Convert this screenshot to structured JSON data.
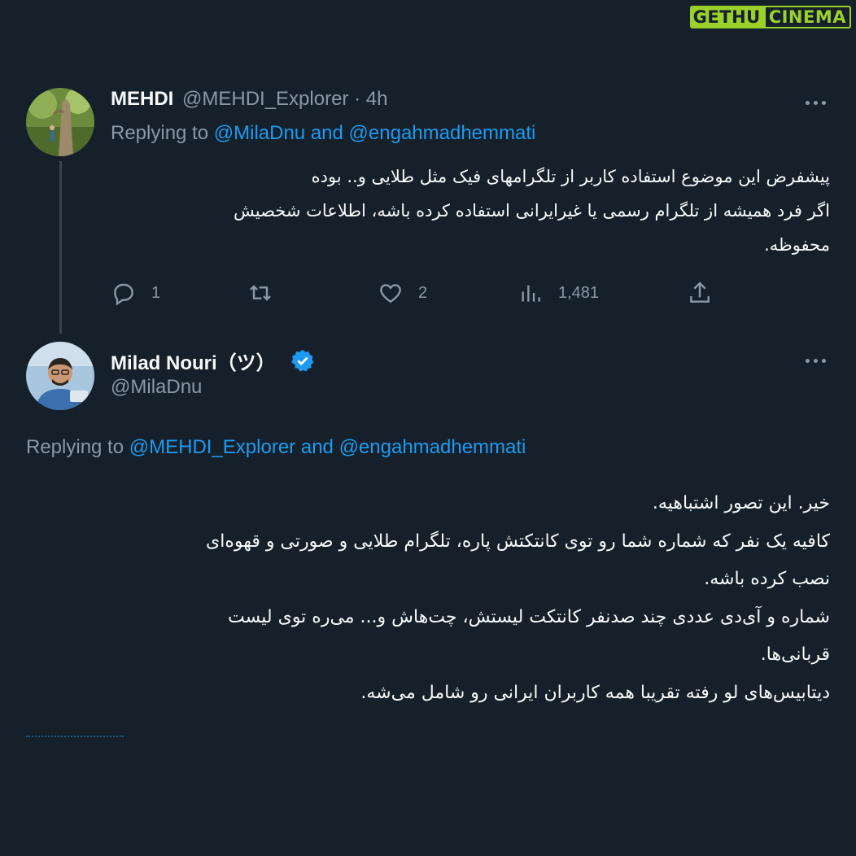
{
  "watermark": {
    "part1": "GETHU",
    "part2": "CINEMA"
  },
  "tweet1": {
    "author_name": "MEHDI",
    "author_handle": "@MEHDI_Explorer",
    "time": "· 4h",
    "replying_prefix": "Replying to",
    "replying_to_1": "@MilaDnu",
    "replying_and": "and",
    "replying_to_2": "@engahmadhemmati",
    "text_lines": [
      "پیشفرض این موضوع استفاده کاربر از تلگرامهای فیک مثل طلایی و..  بوده",
      "اگر فرد همیشه از تلگرام رسمی یا غیرایرانی استفاده کرده باشه، اطلاعات شخصیش",
      "محفوظه."
    ],
    "actions": {
      "replies": "1",
      "retweets": "",
      "likes": "2",
      "views": "1,481"
    }
  },
  "tweet2": {
    "author_name": "Milad Nouri（ツ）",
    "author_handle": "@MilaDnu",
    "verified": true,
    "replying_prefix": "Replying to",
    "replying_to_1": "@MEHDI_Explorer",
    "replying_and": "and",
    "replying_to_2": "@engahmadhemmati",
    "text_lines": [
      "خیر. این تصور اشتباهیه.",
      "کافیه یک نفر که شماره شما رو توی کانتکتش پاره، تلگرام طلایی و صورتی و قهوه‌ای",
      "نصب کرده باشه.",
      "شماره و آی‌دی عددی چند صدنفر کانتکت لیستش، چت‌هاش و... می‌ره توی لیست",
      "قربانی‌ها.",
      "دیتابیس‌های لو رفته تقریبا همه کاربران ایرانی رو شامل می‌شه."
    ]
  },
  "colors": {
    "background": "#15202b",
    "accent": "#1d9bf0",
    "muted": "#8b98a5",
    "text": "#f7f9f9",
    "watermark": "#9bd12a"
  }
}
